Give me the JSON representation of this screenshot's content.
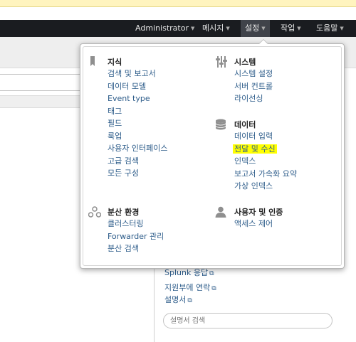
{
  "navbar": {
    "items": [
      {
        "label": "Administrator"
      },
      {
        "label": "메시지"
      },
      {
        "label": "설정"
      },
      {
        "label": "작업"
      },
      {
        "label": "도움말"
      }
    ]
  },
  "help": {
    "links": [
      "Splunk 응답",
      "지원부에 연락",
      "설명서"
    ],
    "search_placeholder": "설명서 검색"
  },
  "dropdown": {
    "knowledge": {
      "title": "지식",
      "items": [
        "검색 및 보고서",
        "데이터 모델",
        "Event type",
        "태그",
        "필드",
        "룩업",
        "사용자 인터페이스",
        "고급 검색",
        "모든 구성"
      ]
    },
    "system": {
      "title": "시스템",
      "items": [
        "시스템 설정",
        "서버 컨트롤",
        "라이선싱"
      ]
    },
    "data": {
      "title": "데이터",
      "items": [
        "데이터 입력",
        "전달 및 수신",
        "인덱스",
        "보고서 가속화 요약",
        "가상 인덱스"
      ],
      "highlighted_item": "전달 및 수신",
      "highlight_color": "#ffff00"
    },
    "distributed": {
      "title": "분산 환경",
      "items": [
        "클러스터링",
        "Forwarder 관리",
        "분산 검색"
      ]
    },
    "users": {
      "title": "사용자 및 인증",
      "items": [
        "액세스 제어"
      ]
    }
  },
  "icons": {
    "knowledge": "bookmark-icon",
    "system": "sliders-icon",
    "data": "database-icon",
    "distributed": "distributed-nodes-icon",
    "users": "user-icon",
    "external": "external-link-icon",
    "caret": "caret-down-icon"
  },
  "colors": {
    "navbar_bg": "#1a1c20",
    "link": "#2d5c8a",
    "top_strip": "#fff4bf"
  }
}
